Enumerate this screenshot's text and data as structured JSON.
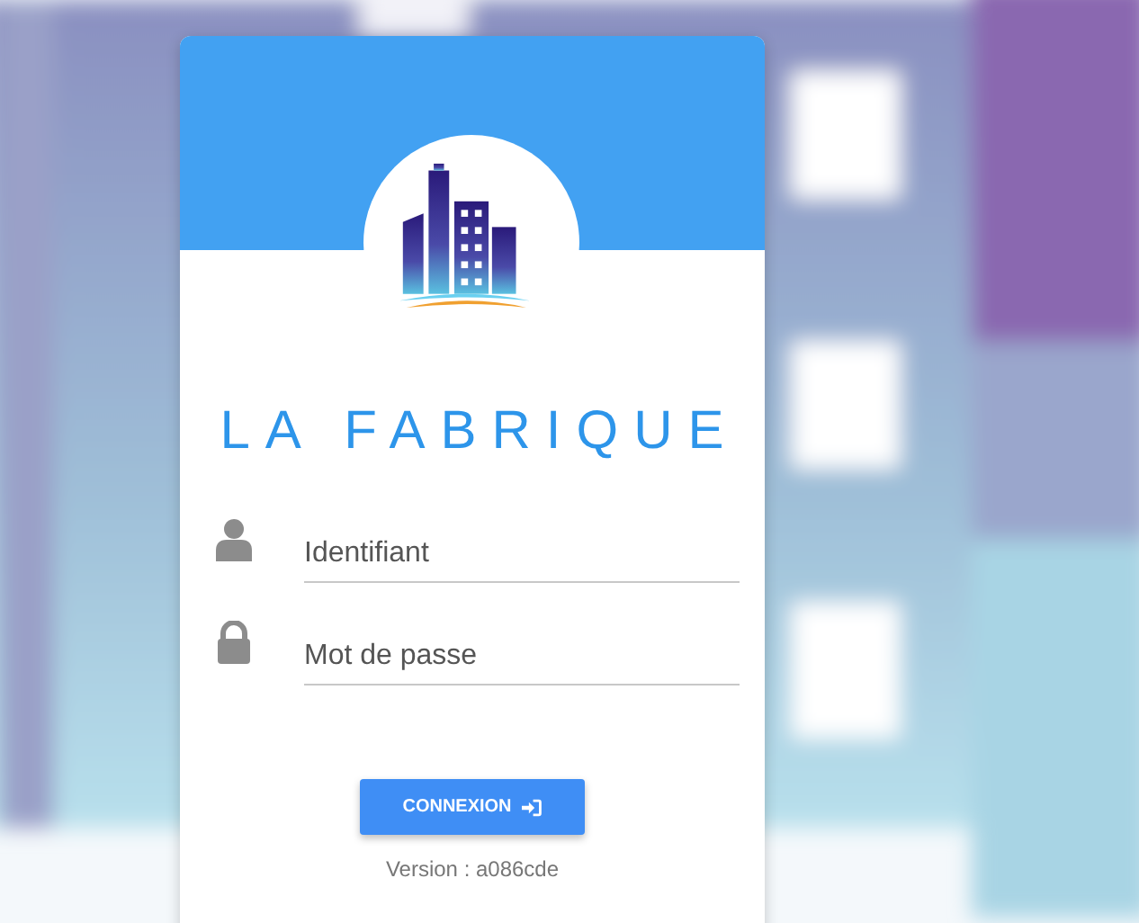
{
  "brand": {
    "title": "LA FABRIQUE"
  },
  "fields": [
    {
      "kind": "user",
      "placeholder": "Identifiant"
    },
    {
      "kind": "password",
      "placeholder": "Mot de passe"
    }
  ],
  "button": {
    "label": "CONNEXION"
  },
  "version": "Version : a086cde"
}
